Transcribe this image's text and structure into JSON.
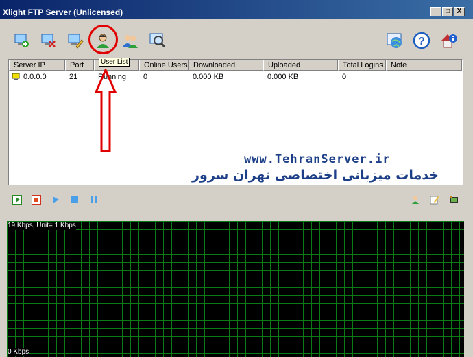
{
  "window": {
    "title": "Xlight FTP Server (Unlicensed)",
    "buttons": {
      "minimize": "_",
      "maximize": "□",
      "close": "X"
    }
  },
  "toolbar": {
    "left_icons": [
      "add-server-icon",
      "remove-server-icon",
      "edit-server-icon",
      "user-list-icon",
      "user-groups-icon",
      "search-icon"
    ],
    "right_icons": [
      "network-globe-icon",
      "help-icon",
      "home-info-icon"
    ]
  },
  "tooltip": "User List",
  "table": {
    "columns": [
      "Server IP",
      "Port",
      "Status",
      "Online Users",
      "Downloaded",
      "Uploaded",
      "Total Logins",
      "Note"
    ],
    "rows": [
      {
        "server_ip": "0.0.0.0",
        "port": "21",
        "status": "Running",
        "online_users": "0",
        "downloaded": "0.000 KB",
        "uploaded": "0.000 KB",
        "total_logins": "0",
        "note": ""
      }
    ]
  },
  "watermark": {
    "url": "www.TehranServer.ir",
    "tagline": "خدمات میزبانی اختصاصی تهران سرور"
  },
  "controls": {
    "left": [
      "start-icon",
      "stop-icon",
      "play-icon",
      "stop-square-icon",
      "pause-icon"
    ],
    "right": [
      "user-icon",
      "edit-note-icon",
      "log-icon"
    ]
  },
  "graph": {
    "top_label": "19 Kbps, Unit= 1 Kbps",
    "bottom_label": "0 Kbps"
  },
  "colors": {
    "title_bar": "#0a246a",
    "graph_bg": "#000000",
    "grid": "#0a7a14",
    "annotation": "#e10000",
    "watermark": "#1c3f88"
  }
}
